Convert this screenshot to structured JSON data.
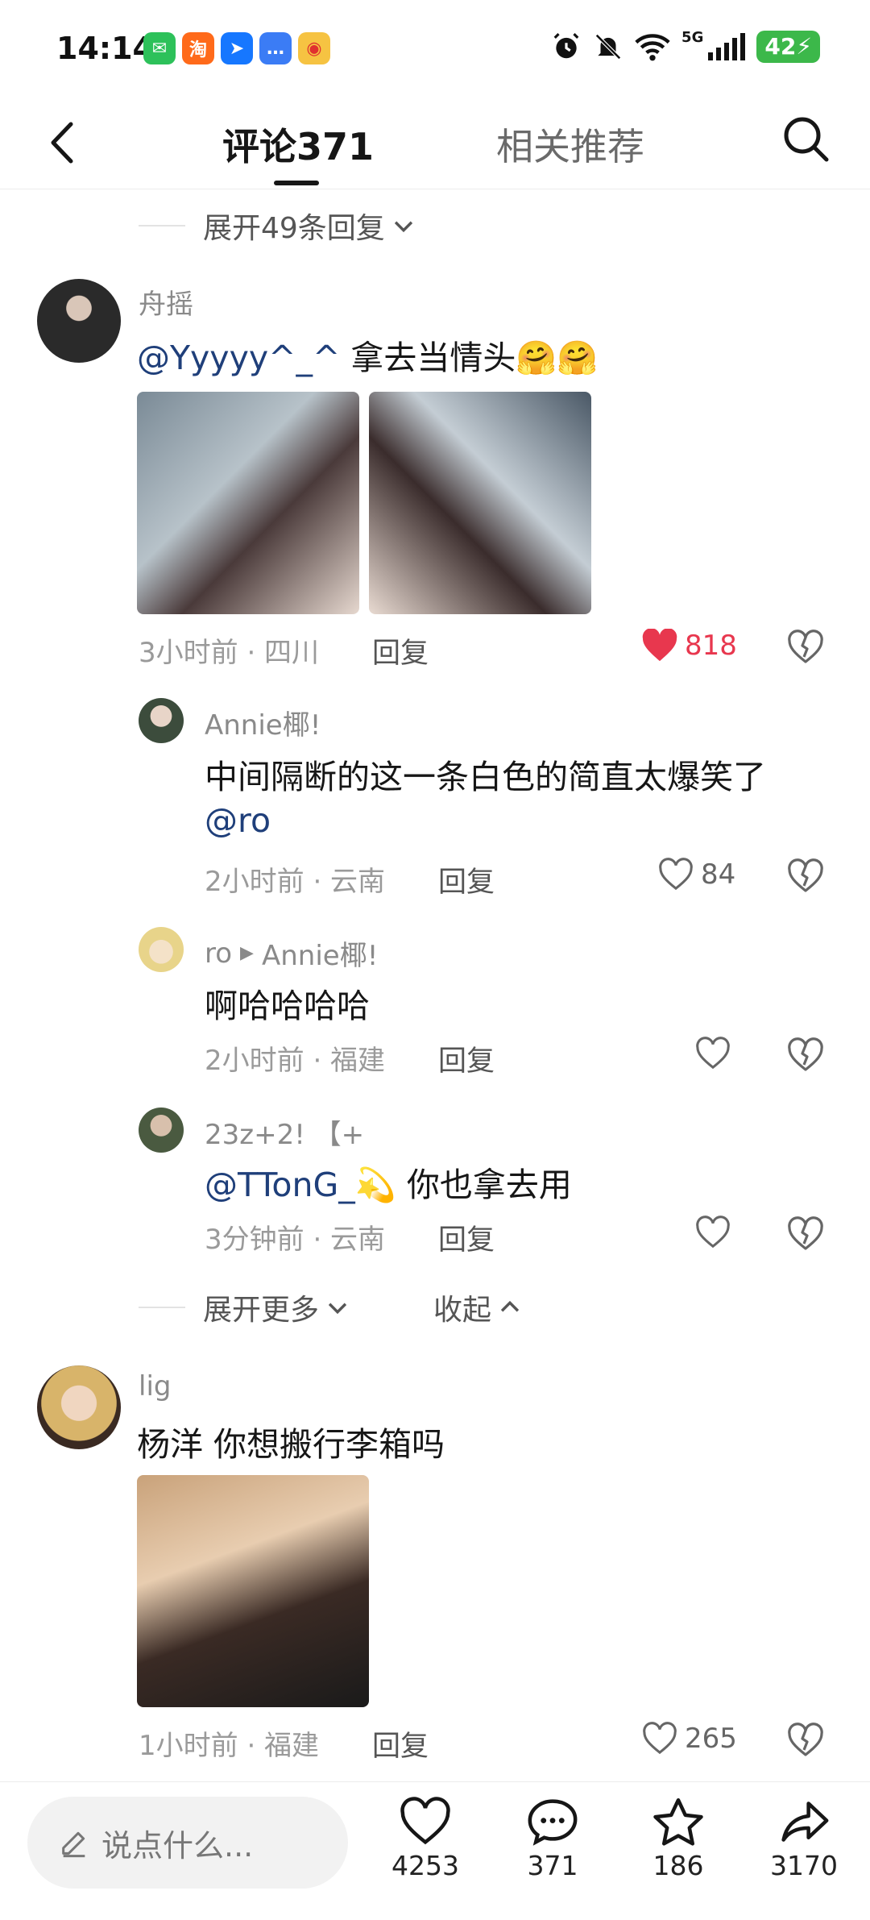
{
  "status": {
    "time": "14:14",
    "battery": "42",
    "network": "5G",
    "app_icons": [
      "wechat-icon",
      "taobao-icon",
      "navigation-icon",
      "message-icon",
      "weibo-icon"
    ]
  },
  "nav": {
    "tab_comments": "评论371",
    "tab_related": "相关推荐"
  },
  "top_expand": "展开49条回复",
  "comments": [
    {
      "user": "舟摇",
      "mention": "@Yyyyy^_^",
      "text": " 拿去当情头🤗🤗",
      "time": "3小时前 · 四川",
      "reply": "回复",
      "likes": "818",
      "liked": true
    },
    {
      "user": "lig",
      "text": "杨洋 你想搬行李箱吗",
      "time": "1小时前 · 福建",
      "reply": "回复",
      "likes": "265",
      "liked": false
    }
  ],
  "replies": [
    {
      "user": "Annie椰!",
      "text": "中间隔断的这一条白色的简直太爆笑了",
      "mention": "@ro",
      "time": "2小时前 · 云南",
      "reply": "回复",
      "likes": "84"
    },
    {
      "user": "ro",
      "reply_to": "Annie椰!",
      "text": "啊哈哈哈哈",
      "time": "2小时前 · 福建",
      "reply": "回复",
      "likes": ""
    },
    {
      "user": "23z+2! 【+",
      "mention": "@TTonG_💫",
      "text": " 你也拿去用",
      "time": "3分钟前 · 云南",
      "reply": "回复",
      "likes": ""
    }
  ],
  "expand_more": "展开更多",
  "collapse": "收起",
  "bottom": {
    "input_placeholder": "说点什么...",
    "likes": "4253",
    "comments": "371",
    "favorites": "186",
    "shares": "3170"
  },
  "colors": {
    "like_red": "#e8374e",
    "mention_blue": "#1f3f7a",
    "battery_green": "#3cb84a"
  }
}
